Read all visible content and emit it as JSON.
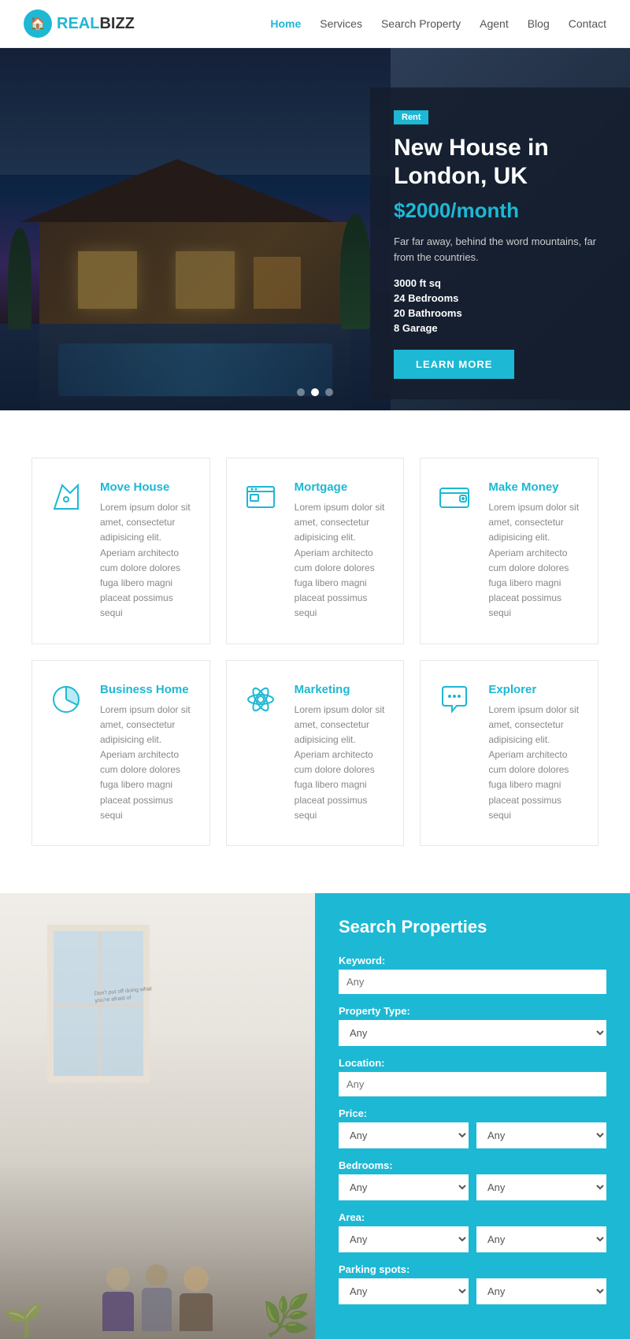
{
  "navbar": {
    "logo_real": "REAL",
    "logo_bizz": "BIZZ",
    "nav_items": [
      {
        "label": "Home",
        "active": true
      },
      {
        "label": "Services",
        "active": false
      },
      {
        "label": "Search Property",
        "active": false
      },
      {
        "label": "Agent",
        "active": false
      },
      {
        "label": "Blog",
        "active": false
      },
      {
        "label": "Contact",
        "active": false
      }
    ]
  },
  "hero": {
    "badge": "Rent",
    "title": "New House in London, UK",
    "price": "$2000/month",
    "description": "Far far away, behind the word mountains, far from the countries.",
    "features": [
      "3000 ft sq",
      "24 Bedrooms",
      "20 Bathrooms",
      "8 Garage"
    ],
    "button_label": "LEARN MORE",
    "dots": [
      false,
      true,
      false
    ]
  },
  "services": {
    "items": [
      {
        "icon": "map",
        "title": "Move House",
        "desc": "Lorem ipsum dolor sit amet, consectetur adipisicing elit. Aperiam architecto cum dolore dolores fuga libero magni placeat possimus sequi"
      },
      {
        "icon": "browser",
        "title": "Mortgage",
        "desc": "Lorem ipsum dolor sit amet, consectetur adipisicing elit. Aperiam architecto cum dolore dolores fuga libero magni placeat possimus sequi"
      },
      {
        "icon": "wallet",
        "title": "Make Money",
        "desc": "Lorem ipsum dolor sit amet, consectetur adipisicing elit. Aperiam architecto cum dolore dolores fuga libero magni placeat possimus sequi"
      },
      {
        "icon": "pie",
        "title": "Business Home",
        "desc": "Lorem ipsum dolor sit amet, consectetur adipisicing elit. Aperiam architecto cum dolore dolores fuga libero magni placeat possimus sequi"
      },
      {
        "icon": "atom",
        "title": "Marketing",
        "desc": "Lorem ipsum dolor sit amet, consectetur adipisicing elit. Aperiam architecto cum dolore dolores fuga libero magni placeat possimus sequi"
      },
      {
        "icon": "chat",
        "title": "Explorer",
        "desc": "Lorem ipsum dolor sit amet, consectetur adipisicing elit. Aperiam architecto cum dolore dolores fuga libero magni placeat possimus sequi"
      }
    ]
  },
  "search": {
    "title": "Search Properties",
    "fields": [
      {
        "label": "Keyword:",
        "type": "text",
        "placeholder": "Any",
        "double": false
      },
      {
        "label": "Property Type:",
        "type": "select",
        "placeholder": "Any",
        "double": false
      },
      {
        "label": "Location:",
        "type": "text",
        "placeholder": "Any",
        "double": false
      },
      {
        "label": "Price:",
        "type": "double-select",
        "placeholder1": "Any",
        "placeholder2": "Any",
        "double": true
      },
      {
        "label": "Bedrooms:",
        "type": "double-select",
        "placeholder1": "Any",
        "placeholder2": "Any",
        "double": true
      },
      {
        "label": "Area:",
        "type": "double-select",
        "placeholder1": "Any",
        "placeholder2": "Any",
        "double": true
      },
      {
        "label": "Parking spots:",
        "type": "double-select",
        "placeholder1": "Any",
        "placeholder2": "Any",
        "double": true
      }
    ]
  },
  "colors": {
    "primary": "#1db8d4",
    "dark": "#333",
    "text": "#888"
  }
}
